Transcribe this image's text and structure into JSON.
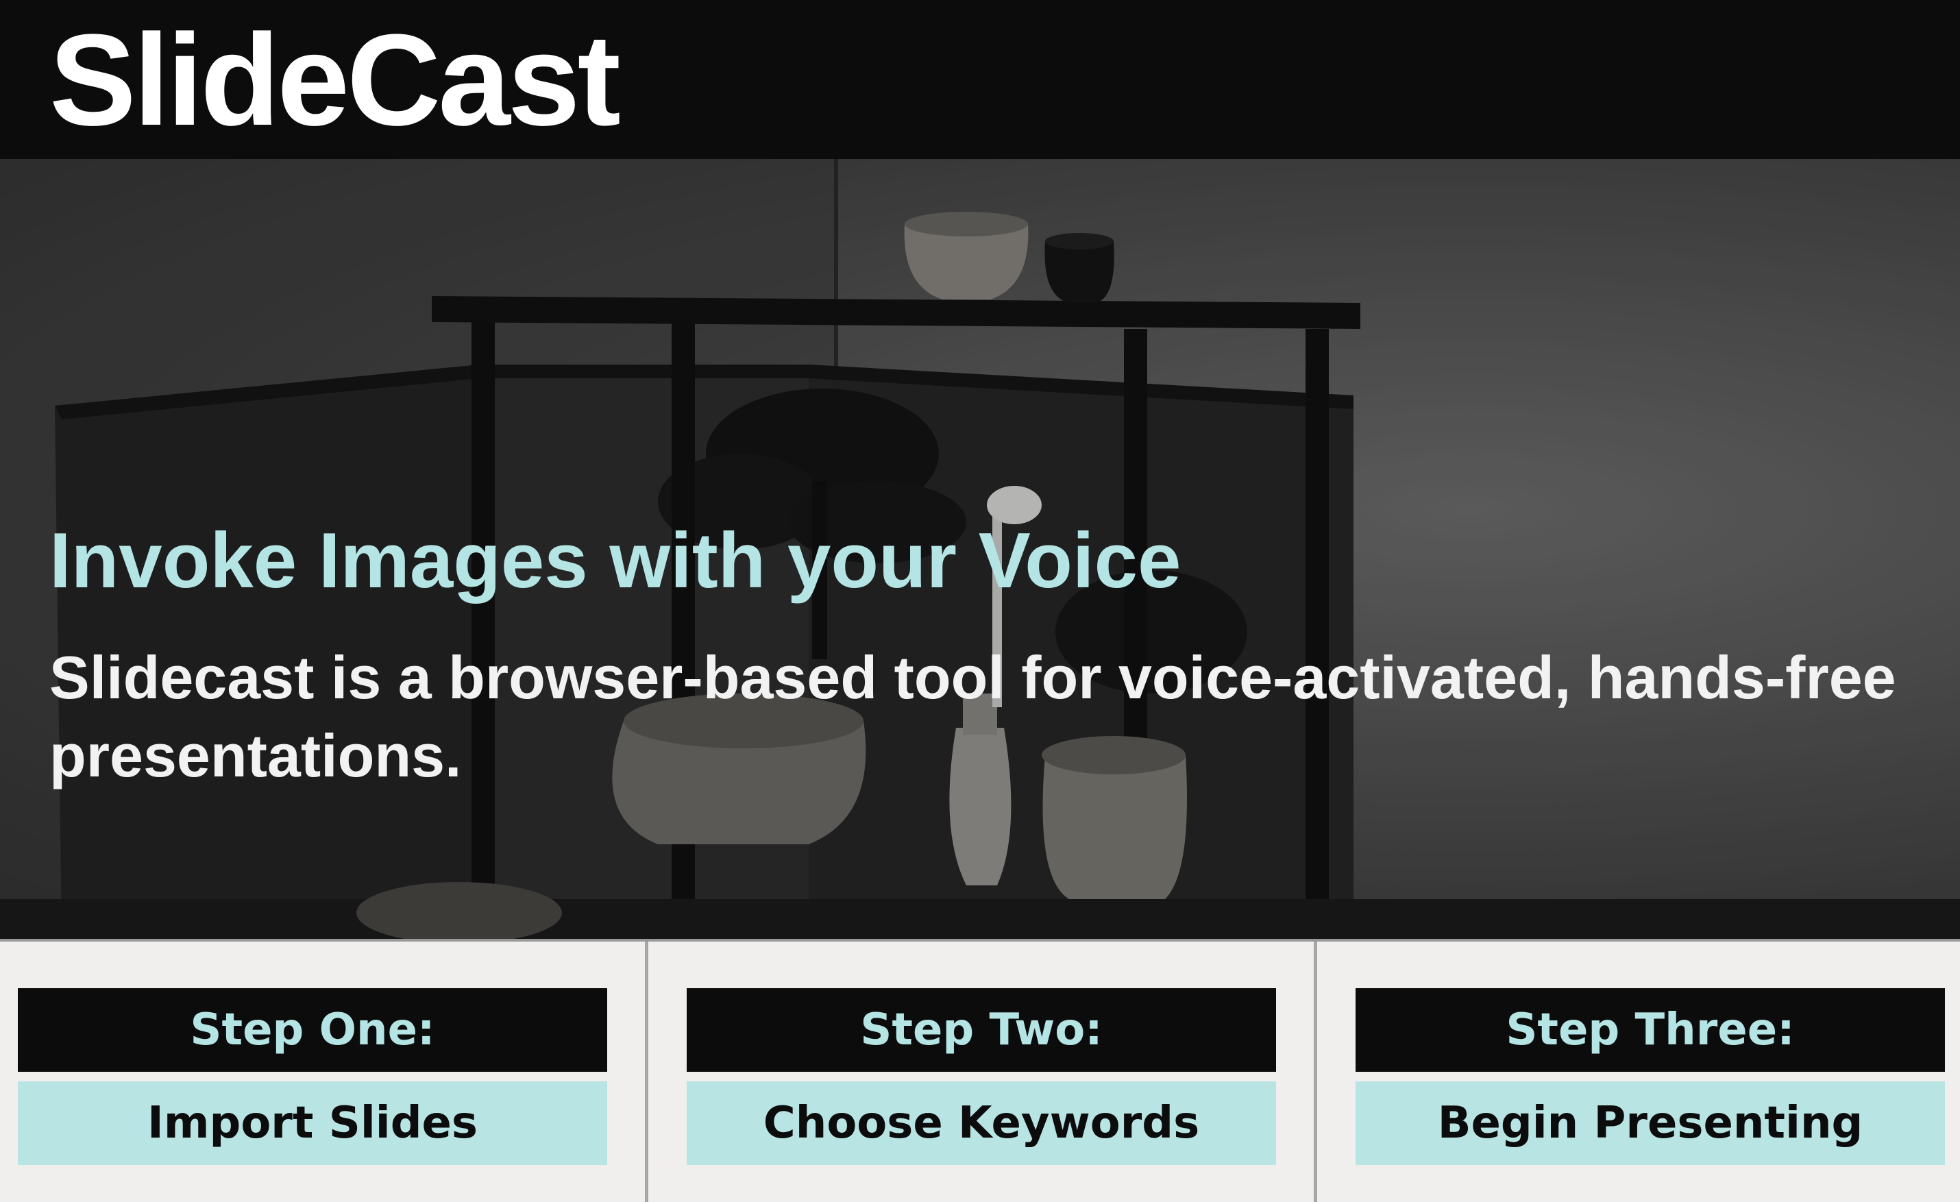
{
  "header": {
    "logo": "SlideCast"
  },
  "hero": {
    "title": "Invoke Images with your Voice",
    "subtitle": "Slidecast is a browser-based tool for voice-activated, hands-free presentations."
  },
  "steps": [
    {
      "heading": "Step One:",
      "action": "Import Slides"
    },
    {
      "heading": "Step Two:",
      "action": "Choose Keywords"
    },
    {
      "heading": "Step Three:",
      "action": "Begin Presenting"
    }
  ],
  "colors": {
    "header_bg": "#0c0c0c",
    "accent": "#b4e4e3",
    "action_bg": "#b8e5e4",
    "steps_bg": "#f0efed"
  }
}
